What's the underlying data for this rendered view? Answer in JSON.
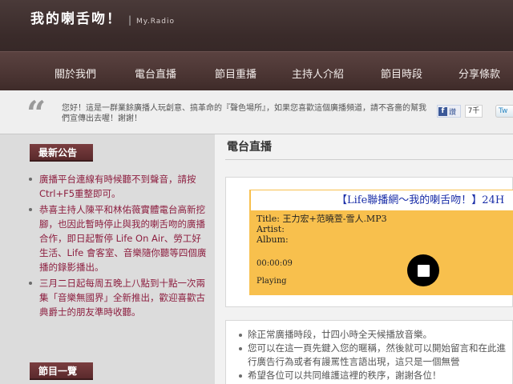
{
  "header": {
    "logo_text": "我的喇舌吻！",
    "logo_sep": "|",
    "logo_sub": "My.Radio"
  },
  "nav": {
    "items": [
      {
        "label": "關於我們"
      },
      {
        "label": "電台直播"
      },
      {
        "label": "節目重播"
      },
      {
        "label": "主持人介紹"
      },
      {
        "label": "節目時段"
      },
      {
        "label": "分享條款"
      }
    ]
  },
  "notice": {
    "quote_glyph": "“",
    "text": "您好！這是一群業餘廣播人玩創意、搞革命的『聲色場所』，如果您喜歡這個廣播頻道，請不吝嗇的幫我們宣傳出去喔！謝謝！",
    "facebook_label": "f",
    "facebook_action": "讚",
    "facebook_count": "7千",
    "twitter_label": "Tw"
  },
  "sidebar": {
    "news_title": "最新公告",
    "news": [
      "廣播平台連線有時候聽不到聲音，請按Ctrl+F5重整即可。",
      "恭喜主持人陳平和林佑薇實體電台高新挖腳，也因此暫時停止與我的喇舌吻的廣播合作，即日起暫停 Life On Air、勞工好生活、Life 會客室、音樂隨你聽等四個廣播的錄影播出。",
      "三月二日起每周五晚上八點到十點一次兩集「音樂無國界」全新推出，歡迎喜歡古典爵士的朋友準時收聽。"
    ],
    "program_title": "節目一覽"
  },
  "main": {
    "page_title": "電台直播",
    "player": {
      "marquee": "【Life聯播網～我的喇舌吻！】24H",
      "title_line": "Title: 王力宏+范曉萱-雪人.MP3",
      "artist_line": "Artist:",
      "album_line": "Album:",
      "time": "00:00:09",
      "status": "Playing"
    },
    "info": [
      "除正常廣播時段，廿四小時全天候播放音樂。",
      "您可以在這一頁先鍵入您的暱稱，然後就可以開始留言和在此進行廣告行為或者有謾罵性言語出現，這只是一個無營",
      "希望各位可以共同維護這裡的秩序，謝謝各位！"
    ]
  },
  "colors": {
    "header_bg": "#3a2b2a",
    "nav_text": "#f2ecea",
    "news_text": "#8d1f40",
    "side_title_bg": "#6a3335",
    "player_bg": "#f8c04d",
    "marquee_text": "#1a2ea8"
  }
}
